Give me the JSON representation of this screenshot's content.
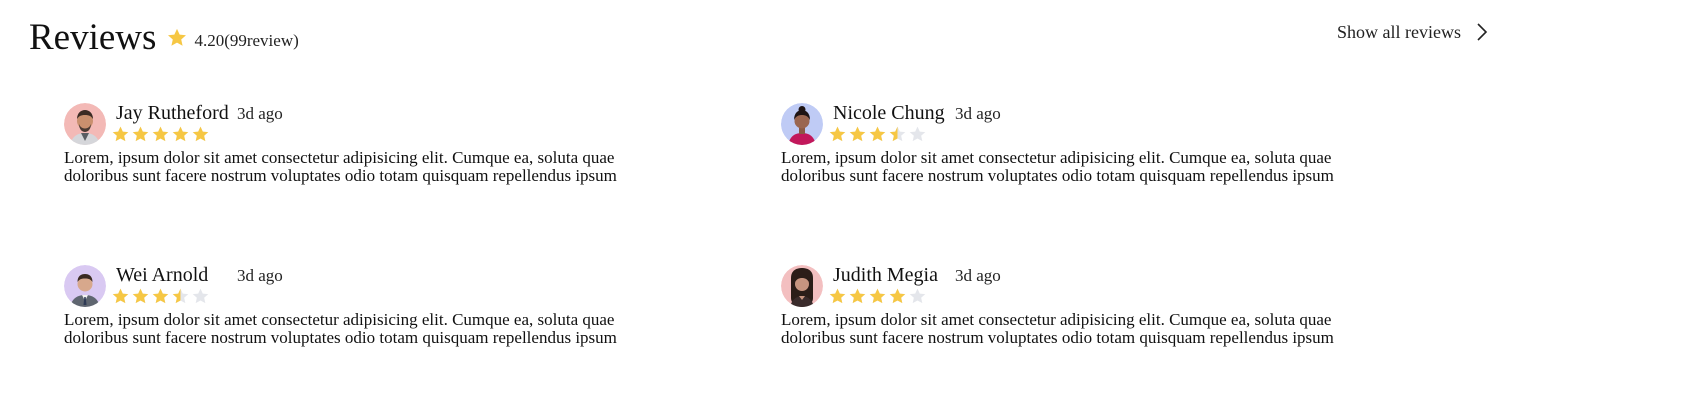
{
  "header": {
    "title": "Reviews",
    "rating_text": "4.20(99review)",
    "icon": "star-icon"
  },
  "show_all": {
    "label": "Show all reviews",
    "icon": "chevron-right-icon"
  },
  "colors": {
    "star_filled": "#F6C744",
    "star_empty": "#E4E6EB",
    "text": "#111111"
  },
  "reviews": [
    {
      "name": "Jay Rutheford",
      "time": "3d ago",
      "rating": 5,
      "avatar_icon": "avatar-jay",
      "text_line1": "Lorem, ipsum dolor sit amet consectetur adipisicing elit. Cumque ea, soluta quae",
      "text_line2": "doloribus sunt facere nostrum voluptates odio totam quisquam repellendus ipsum"
    },
    {
      "name": "Nicole Chung",
      "time": "3d ago",
      "rating": 3.5,
      "avatar_icon": "avatar-nicole",
      "text_line1": "Lorem, ipsum dolor sit amet consectetur adipisicing elit. Cumque ea, soluta quae",
      "text_line2": "doloribus sunt facere nostrum voluptates odio totam quisquam repellendus ipsum"
    },
    {
      "name": "Wei Arnold",
      "time": "3d ago",
      "rating": 3.5,
      "avatar_icon": "avatar-wei",
      "text_line1": "Lorem, ipsum dolor sit amet consectetur adipisicing elit. Cumque ea, soluta quae",
      "text_line2": "doloribus sunt facere nostrum voluptates odio totam quisquam repellendus ipsum"
    },
    {
      "name": "Judith Megia",
      "time": "3d ago",
      "rating": 4,
      "avatar_icon": "avatar-judith",
      "text_line1": "Lorem, ipsum dolor sit amet consectetur adipisicing elit. Cumque ea, soluta quae",
      "text_line2": "doloribus sunt facere nostrum voluptates odio totam quisquam repellendus ipsum"
    }
  ]
}
